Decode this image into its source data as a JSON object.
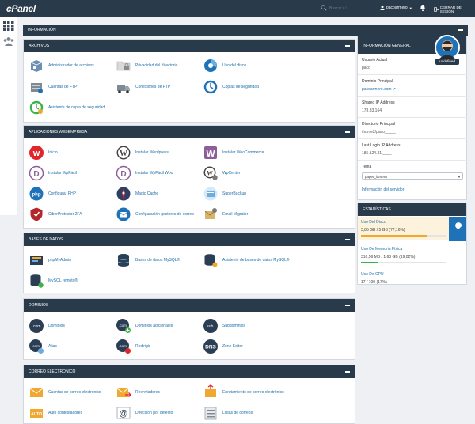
{
  "topbar": {
    "logo": "cPanel",
    "search_placeholder": "Buscar ( / )",
    "username": "pacoarmero",
    "logout": "CERRAR DE SESIÓN"
  },
  "info_bar": {
    "title": "INFORMACIÓN"
  },
  "sections": {
    "archivos": {
      "title": "ARCHIVOS",
      "items": [
        {
          "label": "Administrador de archivos"
        },
        {
          "label": "Privacidad del directorio"
        },
        {
          "label": "Uso del disco"
        },
        {
          "label": "Cuentas de FTP"
        },
        {
          "label": "Conexiones de FTP"
        },
        {
          "label": "Copias de seguridad"
        },
        {
          "label": "Asistente de copia de seguridad"
        }
      ]
    },
    "aplicaciones": {
      "title": "APLICACIONES WEBEMPRESA",
      "items": [
        {
          "label": "Inicio"
        },
        {
          "label": "Instalar Wordpress"
        },
        {
          "label": "Instalar WooCommerce"
        },
        {
          "label": "Instalar WpFácil"
        },
        {
          "label": "Instalar WpFácil Woo"
        },
        {
          "label": "WpCenter"
        },
        {
          "label": "Configurar PHP"
        },
        {
          "label": "Magic Cache"
        },
        {
          "label": "SuperBackup"
        },
        {
          "label": "CiberProtector 2FA"
        },
        {
          "label": "Configuración gestores de correo"
        },
        {
          "label": "Email Migrator"
        }
      ]
    },
    "bases": {
      "title": "BASES DE DATOS",
      "items": [
        {
          "label": "phpMyAdmin"
        },
        {
          "label": "Bases de datos MySQL®"
        },
        {
          "label": "Asistente de bases de datos MySQL®"
        },
        {
          "label": "MySQL remoto®"
        }
      ]
    },
    "dominios": {
      "title": "DOMINIOS",
      "items": [
        {
          "label": "Dominios"
        },
        {
          "label": "Dominios adicionales"
        },
        {
          "label": "Subdominios"
        },
        {
          "label": "Alias"
        },
        {
          "label": "Redirigir"
        },
        {
          "label": "Zone Editor"
        }
      ]
    },
    "correo": {
      "title": "CORREO ELECTRÓNICO",
      "items": [
        {
          "label": "Cuentas de correo electrónico"
        },
        {
          "label": "Reenviadores"
        },
        {
          "label": "Enrutamiento de correo electrónico"
        },
        {
          "label": "Auto contestadores"
        },
        {
          "label": "Dirección por defecto"
        },
        {
          "label": "Listas de correos"
        }
      ]
    }
  },
  "general_info": {
    "title": "INFORMACIÓN GENERAL",
    "avatar_name": "undefined",
    "current_user_label": "Usuario Actual",
    "current_user": "paco",
    "main_domain_label": "Dominio Principal",
    "main_domain": "pacoarmero.com",
    "shared_ip_label": "Shared IP Address",
    "shared_ip": "178.33.164.____",
    "home_dir_label": "Directorio Principal",
    "home_dir": "/home2/paco_____",
    "last_login_label": "Last Login IP Address",
    "last_login": "185.124.31.____",
    "theme_label": "Tema",
    "theme_value": "paper_lantern",
    "server_info": "Información del servidor"
  },
  "stats": {
    "title": "ESTADÍSTICAS",
    "disk_label": "Uso Del Disco",
    "disk_value": "3,85 GB / 5 GB   (77,16%)",
    "disk_pct": 77.16,
    "mem_label": "Uso De Memoria Física",
    "mem_value": "316,56 MB / 1,63 GB   (19,02%)",
    "mem_pct": 19.02,
    "cpu_label": "Uso De CPU",
    "cpu_value": "17 / 100   (17%)"
  },
  "colors": {
    "navy": "#293a4a",
    "link": "#1d6ea8",
    "accent_orange": "#f0a830",
    "accent_green": "#3cb34a"
  }
}
